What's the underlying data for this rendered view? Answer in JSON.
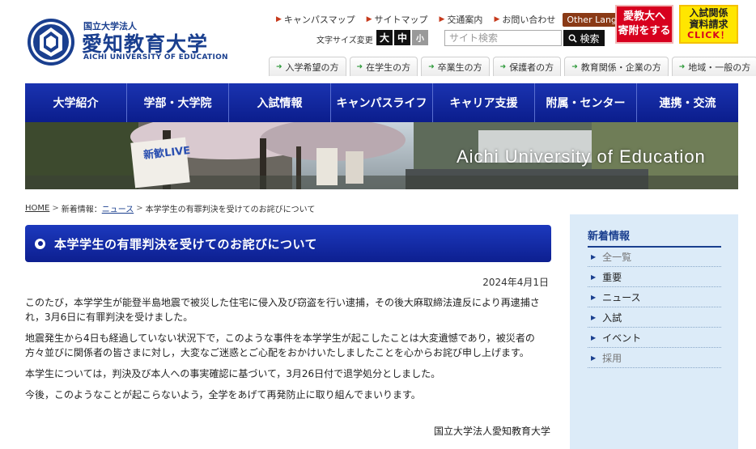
{
  "header": {
    "logo_sub": "国立大学法人",
    "logo_name": "愛知教育大学",
    "logo_en": "AICHI UNIVERSITY OF EDUCATION",
    "utility_links": [
      "キャンパスマップ",
      "サイトマップ",
      "交通案内",
      "お問い合わせ"
    ],
    "other_languages": "Other Languages",
    "fontsize_label": "文字サイズ変更",
    "fontsize_large": "大",
    "fontsize_medium": "中",
    "fontsize_small": "小",
    "search_placeholder": "サイト検索",
    "search_button": "検索",
    "donate_line1": "愛教大へ",
    "donate_line2": "寄附をする",
    "request_line1": "入試関係",
    "request_line2": "資料請求",
    "request_line3": "CLICK！",
    "audience_tabs": [
      "入学希望の方",
      "在学生の方",
      "卒業生の方",
      "保護者の方",
      "教育関係・企業の方",
      "地域・一般の方"
    ]
  },
  "nav": {
    "items": [
      "大学紹介",
      "学部・大学院",
      "入試情報",
      "キャンパスライフ",
      "キャリア支援",
      "附属・センター",
      "連携・交流"
    ]
  },
  "hero": {
    "caption": "Aichi University of Education",
    "sign_text": "新歓LIVE"
  },
  "breadcrumb": {
    "home": "HOME",
    "news_parent": "新着情報：",
    "news": "ニュース",
    "current": "本学学生の有罪判決を受けてのお詫びについて"
  },
  "article": {
    "title": "本学学生の有罪判決を受けてのお詫びについて",
    "date": "2024年4月1日",
    "paragraphs": [
      "このたび，本学学生が能登半島地震で被災した住宅に侵入及び窃盗を行い逮捕，その後大麻取締法違反により再逮捕され，3月6日に有罪判決を受けました。",
      "地震発生から4日も経過していない状況下で，このような事件を本学学生が起こしたことは大変遺憾であり，被災者の方々並びに関係者の皆さまに対し，大変なご迷惑とご心配をおかけいたしましたことを心からお詫び申し上げます。",
      "本学生については，判決及び本人への事実確認に基づいて，3月26日付で退学処分としました。",
      "今後，このようなことが起こらないよう，全学をあげて再発防止に取り組んでまいります。"
    ],
    "signature": "国立大学法人愛知教育大学"
  },
  "sidebar": {
    "heading": "新着情報",
    "items": [
      "全一覧",
      "重要",
      "ニュース",
      "入試",
      "イベント",
      "採用"
    ]
  },
  "colors": {
    "nav_blue": "#0b1d8c",
    "brand_blue": "#1a3f8f",
    "donate_red": "#d7001e",
    "request_yellow": "#ffe600",
    "other_lang_brown": "#8a3a16",
    "sidebar_bg": "#dcebf8"
  }
}
